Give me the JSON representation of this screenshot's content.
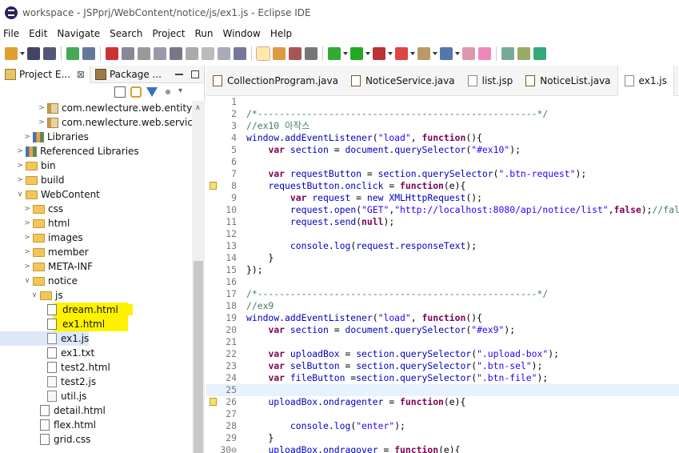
{
  "window": {
    "title": "workspace - JSPprj/WebContent/notice/js/ex1.js - Eclipse IDE"
  },
  "menu": [
    "File",
    "Edit",
    "Navigate",
    "Search",
    "Project",
    "Run",
    "Window",
    "Help"
  ],
  "left_panel": {
    "tabs": [
      {
        "label": "Project E...",
        "close": "⊠"
      },
      {
        "label": "Package ..."
      }
    ],
    "tree": [
      {
        "label": "com.newlecture.web.entity",
        "indent": 5,
        "icon": "package",
        "toggle": ">"
      },
      {
        "label": "com.newlecture.web.service",
        "indent": 5,
        "icon": "package",
        "toggle": ">"
      },
      {
        "label": "Libraries",
        "indent": 3,
        "icon": "library",
        "toggle": ">"
      },
      {
        "label": "Referenced Libraries",
        "indent": 2,
        "icon": "library",
        "toggle": ">"
      },
      {
        "label": "bin",
        "indent": 2,
        "icon": "folder",
        "toggle": ">"
      },
      {
        "label": "build",
        "indent": 2,
        "icon": "folder",
        "toggle": ">"
      },
      {
        "label": "WebContent",
        "indent": 2,
        "icon": "folder",
        "toggle": "v"
      },
      {
        "label": "css",
        "indent": 3,
        "icon": "folder",
        "toggle": ">"
      },
      {
        "label": "html",
        "indent": 3,
        "icon": "folder",
        "toggle": ">"
      },
      {
        "label": "images",
        "indent": 3,
        "icon": "folder",
        "toggle": ">"
      },
      {
        "label": "member",
        "indent": 3,
        "icon": "folder",
        "toggle": ">"
      },
      {
        "label": "META-INF",
        "indent": 3,
        "icon": "folder",
        "toggle": ">"
      },
      {
        "label": "notice",
        "indent": 3,
        "icon": "folder",
        "toggle": "v"
      },
      {
        "label": "js",
        "indent": 4,
        "icon": "folder",
        "toggle": "v"
      },
      {
        "label": "dream.html",
        "indent": 5,
        "icon": "file",
        "toggle": "",
        "highlight": true
      },
      {
        "label": "ex1.html",
        "indent": 5,
        "icon": "file",
        "toggle": "",
        "highlight": true
      },
      {
        "label": "ex1.js",
        "indent": 5,
        "icon": "file-js",
        "toggle": "",
        "selected": true
      },
      {
        "label": "ex1.txt",
        "indent": 5,
        "icon": "file",
        "toggle": ""
      },
      {
        "label": "test2.html",
        "indent": 5,
        "icon": "file",
        "toggle": ""
      },
      {
        "label": "test2.js",
        "indent": 5,
        "icon": "file-js",
        "toggle": ""
      },
      {
        "label": "util.js",
        "indent": 5,
        "icon": "file-js",
        "toggle": ""
      },
      {
        "label": "detail.html",
        "indent": 4,
        "icon": "file",
        "toggle": ""
      },
      {
        "label": "flex.html",
        "indent": 4,
        "icon": "file",
        "toggle": ""
      },
      {
        "label": "grid.css",
        "indent": 4,
        "icon": "file",
        "toggle": ""
      }
    ]
  },
  "editor": {
    "tabs": [
      {
        "label": "CollectionProgram.java",
        "icon": "java"
      },
      {
        "label": "NoticeService.java",
        "icon": "java"
      },
      {
        "label": "list.jsp",
        "icon": "jsp"
      },
      {
        "label": "NoticeList.java",
        "icon": "java"
      },
      {
        "label": "ex1.js",
        "icon": "js",
        "active": true
      }
    ],
    "lines": [
      {
        "n": "1",
        "tokens": []
      },
      {
        "n": "2",
        "tokens": [
          [
            "cm",
            "/*---------------------------------------------------*/"
          ]
        ]
      },
      {
        "n": "3",
        "tokens": [
          [
            "cm",
            "//ex10 아작스"
          ]
        ]
      },
      {
        "n": "4",
        "tokens": [
          [
            "fn",
            "window"
          ],
          [
            "tx",
            "."
          ],
          [
            "fn",
            "addEventListener"
          ],
          [
            "tx",
            "("
          ],
          [
            "st",
            "\"load\""
          ],
          [
            "tx",
            ", "
          ],
          [
            "kw",
            "function"
          ],
          [
            "tx",
            "(){"
          ]
        ]
      },
      {
        "n": "5",
        "tokens": [
          [
            "tx",
            "    "
          ],
          [
            "kw",
            "var"
          ],
          [
            "tx",
            " "
          ],
          [
            "fn",
            "section"
          ],
          [
            "tx",
            " = "
          ],
          [
            "fn",
            "document"
          ],
          [
            "tx",
            "."
          ],
          [
            "fn",
            "querySelector"
          ],
          [
            "tx",
            "("
          ],
          [
            "st",
            "\"#ex10\""
          ],
          [
            "tx",
            ");"
          ]
        ]
      },
      {
        "n": "6",
        "tokens": []
      },
      {
        "n": "7",
        "tokens": [
          [
            "tx",
            "    "
          ],
          [
            "kw",
            "var"
          ],
          [
            "tx",
            " "
          ],
          [
            "fn",
            "requestButton"
          ],
          [
            "tx",
            " = "
          ],
          [
            "fn",
            "section"
          ],
          [
            "tx",
            "."
          ],
          [
            "fn",
            "querySelector"
          ],
          [
            "tx",
            "("
          ],
          [
            "st",
            "\".btn-request\""
          ],
          [
            "tx",
            ");"
          ]
        ]
      },
      {
        "n": "8",
        "mark": true,
        "tokens": [
          [
            "tx",
            "    "
          ],
          [
            "fn",
            "requestButton"
          ],
          [
            "tx",
            "."
          ],
          [
            "fn",
            "onclick"
          ],
          [
            "tx",
            " = "
          ],
          [
            "kw",
            "function"
          ],
          [
            "tx",
            "(e){"
          ]
        ]
      },
      {
        "n": "9",
        "tokens": [
          [
            "tx",
            "        "
          ],
          [
            "kw",
            "var"
          ],
          [
            "tx",
            " "
          ],
          [
            "fn",
            "request"
          ],
          [
            "tx",
            " = "
          ],
          [
            "fn",
            "new"
          ],
          [
            "tx",
            " "
          ],
          [
            "fn",
            "XMLHttpRequest"
          ],
          [
            "tx",
            "();"
          ]
        ]
      },
      {
        "n": "10",
        "tokens": [
          [
            "tx",
            "        "
          ],
          [
            "fn",
            "request"
          ],
          [
            "tx",
            "."
          ],
          [
            "fn",
            "open"
          ],
          [
            "tx",
            "("
          ],
          [
            "st",
            "\"GET\""
          ],
          [
            "tx",
            ","
          ],
          [
            "st",
            "\"http://localhost:8080/api/notice/list\""
          ],
          [
            "tx",
            ","
          ],
          [
            "kw",
            "false"
          ],
          [
            "tx",
            ");"
          ],
          [
            "cm",
            "//fals"
          ]
        ]
      },
      {
        "n": "11",
        "tokens": [
          [
            "tx",
            "        "
          ],
          [
            "fn",
            "request"
          ],
          [
            "tx",
            "."
          ],
          [
            "fn",
            "send"
          ],
          [
            "tx",
            "("
          ],
          [
            "kw",
            "null"
          ],
          [
            "tx",
            ");"
          ]
        ]
      },
      {
        "n": "12",
        "tokens": []
      },
      {
        "n": "13",
        "tokens": [
          [
            "tx",
            "        "
          ],
          [
            "fn",
            "console"
          ],
          [
            "tx",
            "."
          ],
          [
            "fn",
            "log"
          ],
          [
            "tx",
            "("
          ],
          [
            "fn",
            "request"
          ],
          [
            "tx",
            "."
          ],
          [
            "fn",
            "responseText"
          ],
          [
            "tx",
            ");"
          ]
        ]
      },
      {
        "n": "14",
        "tokens": [
          [
            "tx",
            "    }"
          ]
        ]
      },
      {
        "n": "15",
        "tokens": [
          [
            "tx",
            "});"
          ]
        ]
      },
      {
        "n": "16",
        "tokens": []
      },
      {
        "n": "17",
        "tokens": [
          [
            "cm",
            "/*---------------------------------------------------*/"
          ]
        ]
      },
      {
        "n": "18",
        "tokens": [
          [
            "cm",
            "//ex9"
          ]
        ]
      },
      {
        "n": "19",
        "tokens": [
          [
            "fn",
            "window"
          ],
          [
            "tx",
            "."
          ],
          [
            "fn",
            "addEventListener"
          ],
          [
            "tx",
            "("
          ],
          [
            "st",
            "\"load\""
          ],
          [
            "tx",
            ", "
          ],
          [
            "kw",
            "function"
          ],
          [
            "tx",
            "(){"
          ]
        ]
      },
      {
        "n": "20",
        "tokens": [
          [
            "tx",
            "    "
          ],
          [
            "kw",
            "var"
          ],
          [
            "tx",
            " "
          ],
          [
            "fn",
            "section"
          ],
          [
            "tx",
            " = "
          ],
          [
            "fn",
            "document"
          ],
          [
            "tx",
            "."
          ],
          [
            "fn",
            "querySelector"
          ],
          [
            "tx",
            "("
          ],
          [
            "st",
            "\"#ex9\""
          ],
          [
            "tx",
            ");"
          ]
        ]
      },
      {
        "n": "21",
        "tokens": []
      },
      {
        "n": "22",
        "tokens": [
          [
            "tx",
            "    "
          ],
          [
            "kw",
            "var"
          ],
          [
            "tx",
            " "
          ],
          [
            "fn",
            "uploadBox"
          ],
          [
            "tx",
            " = "
          ],
          [
            "fn",
            "section"
          ],
          [
            "tx",
            "."
          ],
          [
            "fn",
            "querySelector"
          ],
          [
            "tx",
            "("
          ],
          [
            "st",
            "\".upload-box\""
          ],
          [
            "tx",
            ");"
          ]
        ]
      },
      {
        "n": "23",
        "tokens": [
          [
            "tx",
            "    "
          ],
          [
            "kw",
            "var"
          ],
          [
            "tx",
            " "
          ],
          [
            "fn",
            "selButton"
          ],
          [
            "tx",
            " = "
          ],
          [
            "fn",
            "section"
          ],
          [
            "tx",
            "."
          ],
          [
            "fn",
            "querySelector"
          ],
          [
            "tx",
            "("
          ],
          [
            "st",
            "\".btn-sel\""
          ],
          [
            "tx",
            ");"
          ]
        ]
      },
      {
        "n": "24",
        "tokens": [
          [
            "tx",
            "    "
          ],
          [
            "kw",
            "var"
          ],
          [
            "tx",
            " "
          ],
          [
            "fn",
            "fileButton"
          ],
          [
            "tx",
            " ="
          ],
          [
            "fn",
            "section"
          ],
          [
            "tx",
            "."
          ],
          [
            "fn",
            "querySelector"
          ],
          [
            "tx",
            "("
          ],
          [
            "st",
            "\".btn-file\""
          ],
          [
            "tx",
            ");"
          ]
        ]
      },
      {
        "n": "25",
        "current": true,
        "tokens": []
      },
      {
        "n": "26",
        "mark": true,
        "tokens": [
          [
            "tx",
            "    "
          ],
          [
            "fn",
            "uploadBox"
          ],
          [
            "tx",
            "."
          ],
          [
            "fn",
            "ondragenter"
          ],
          [
            "tx",
            " = "
          ],
          [
            "kw",
            "function"
          ],
          [
            "tx",
            "(e){"
          ]
        ]
      },
      {
        "n": "27",
        "tokens": []
      },
      {
        "n": "28",
        "tokens": [
          [
            "tx",
            "        "
          ],
          [
            "fn",
            "console"
          ],
          [
            "tx",
            "."
          ],
          [
            "fn",
            "log"
          ],
          [
            "tx",
            "("
          ],
          [
            "st",
            "\"enter\""
          ],
          [
            "tx",
            ");"
          ]
        ]
      },
      {
        "n": "29",
        "tokens": [
          [
            "tx",
            "    }"
          ]
        ]
      },
      {
        "n": "30⊖",
        "tokens": [
          [
            "tx",
            "    "
          ],
          [
            "fn",
            "uploadBox"
          ],
          [
            "tx",
            "."
          ],
          [
            "fn",
            "ondragover"
          ],
          [
            "tx",
            " = "
          ],
          [
            "kw",
            "function"
          ],
          [
            "tx",
            "(e){"
          ]
        ]
      }
    ]
  },
  "colors": {
    "comment": "#3f7f5f",
    "keyword": "#7f0055",
    "string": "#2a00ff",
    "field": "#0000c0",
    "highlight": "#fff200"
  }
}
